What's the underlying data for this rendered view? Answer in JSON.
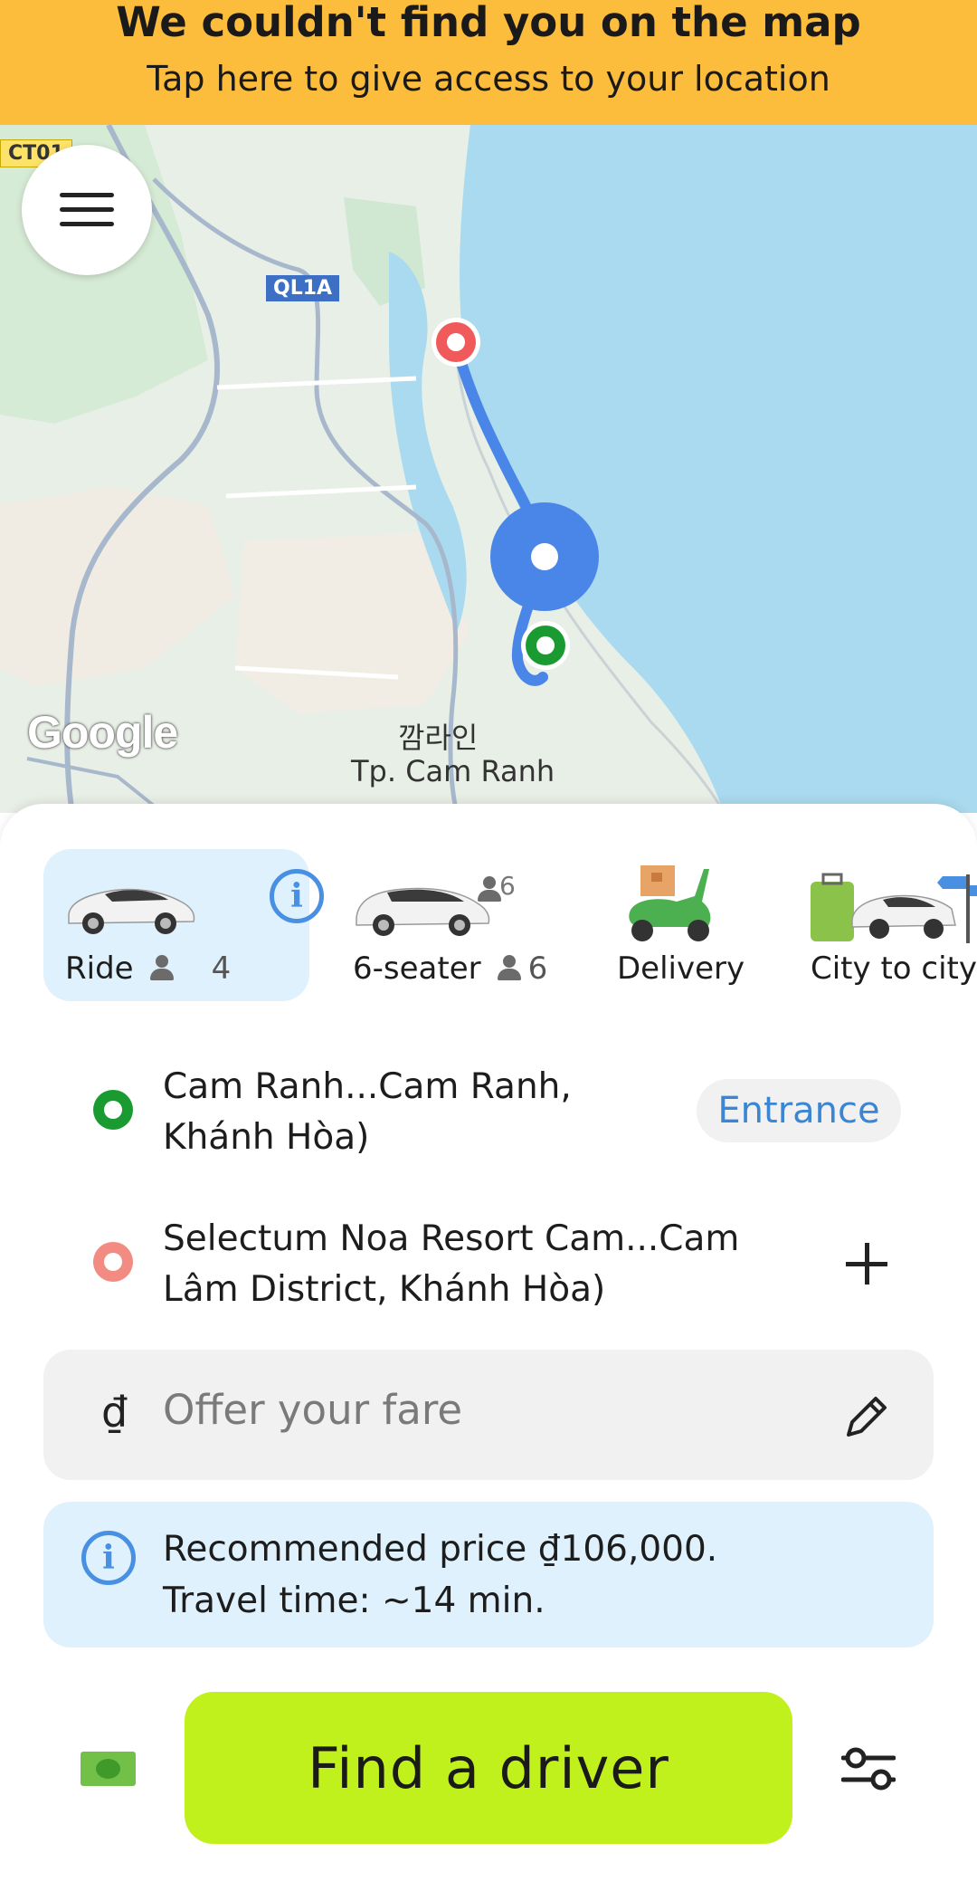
{
  "banner": {
    "title": "We couldn't find you on the map",
    "subtitle": "Tap here to give access to your location"
  },
  "map": {
    "road_labels": [
      "CT01",
      "QL1A"
    ],
    "place_label_korean": "깜라인",
    "place_label": "Tp. Cam Ranh",
    "logo": "Google"
  },
  "services": [
    {
      "label": "Ride",
      "capacity": "4",
      "active": true,
      "icon": "car-icon"
    },
    {
      "label": "6-seater",
      "capacity": "6",
      "badge_capacity": "6",
      "icon": "minivan-icon"
    },
    {
      "label": "Delivery",
      "icon": "scooter-icon"
    },
    {
      "label": "City to city",
      "icon": "luggage-car-icon"
    }
  ],
  "route": {
    "pickup": {
      "line1": "Cam Ranh...Cam Ranh,",
      "line2": "Khánh Hòa)",
      "action": "Entrance",
      "color": "#1a9b32"
    },
    "destination": {
      "line1": "Selectum Noa Resort Cam...Cam",
      "line2": "Lâm District, Khánh Hòa)",
      "color": "#f28b82"
    }
  },
  "fare": {
    "currency": "₫",
    "placeholder": "Offer your fare"
  },
  "recommendation": {
    "line1": "Recommended price ₫106,000.",
    "line2": "Travel time: ~14 min."
  },
  "actions": {
    "find_driver": "Find a driver"
  },
  "colors": {
    "banner": "#fcbc3c",
    "primary_button": "#c1f11d",
    "accent_blue": "#4a90e2",
    "pickup_green": "#1a9b32",
    "destination_red": "#f28b82"
  }
}
